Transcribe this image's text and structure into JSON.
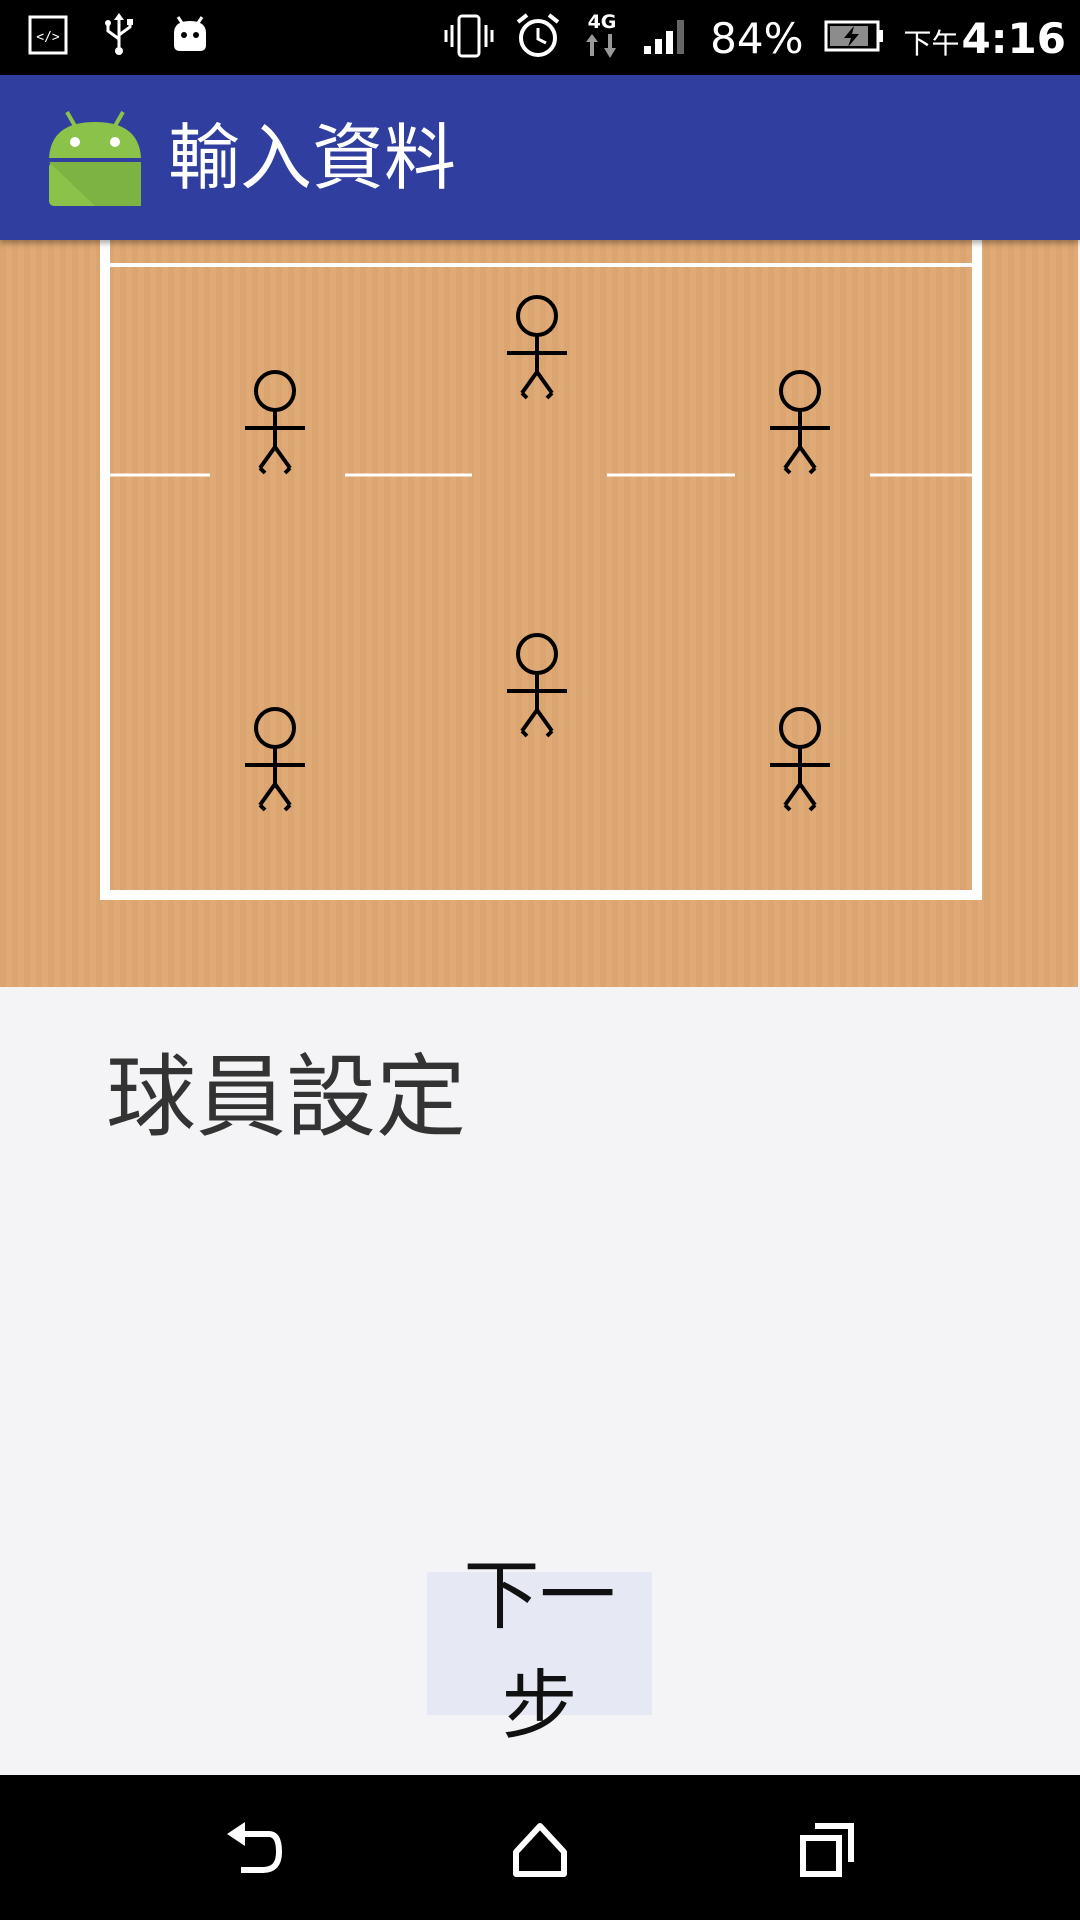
{
  "status_bar": {
    "battery_percent": "84%",
    "time_ampm": "下午",
    "time": "4:16",
    "network_type": "4G",
    "icons": [
      "developer-icon",
      "usb-icon",
      "android-debug-icon",
      "vibrate-icon",
      "alarm-icon",
      "network-4g-icon",
      "signal-icon",
      "battery-charging-icon"
    ]
  },
  "app_bar": {
    "title": "輸入資料",
    "logo_icon": "android-logo-icon",
    "color": "#303f9f"
  },
  "court": {
    "color": "#dfa873",
    "line_color": "#ffffff",
    "player_icon": "stick-figure-icon",
    "player_count": 6
  },
  "main": {
    "player_setting_label": "球員設定",
    "next_button_label": "下一步"
  },
  "nav_bar": {
    "icons": [
      "back-icon",
      "home-icon",
      "recent-apps-icon"
    ]
  }
}
